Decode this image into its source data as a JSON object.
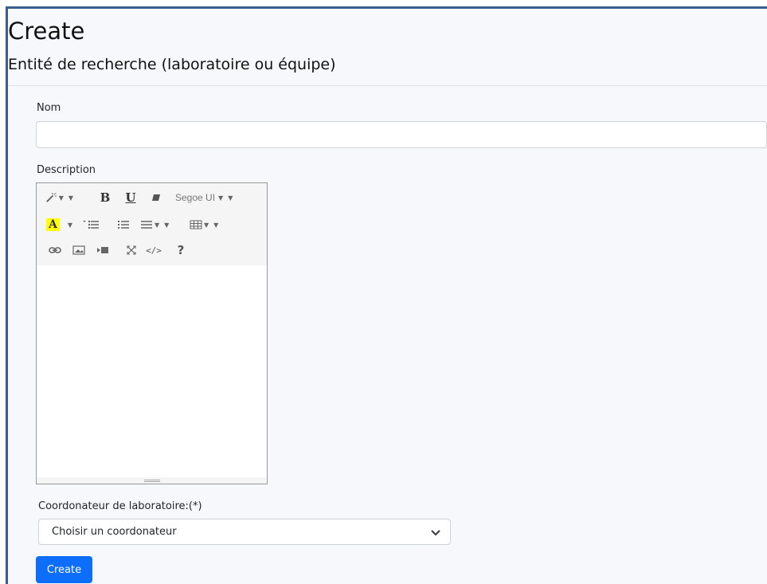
{
  "page": {
    "title": "Create",
    "subtitle": "Entité de recherche (laboratoire ou équipe)"
  },
  "form": {
    "nom_label": "Nom",
    "nom_value": "",
    "description_label": "Description",
    "coordonateur_label": "Coordonateur de laboratoire:(*)",
    "coordonateur_selected": "Choisir un coordonateur",
    "create_button": "Create"
  },
  "editor": {
    "font_name": "Segoe UI",
    "color_letter": "A",
    "help_symbol": "?",
    "code_symbol": "</>",
    "bold_letter": "B",
    "underline_letter": "U",
    "toolbar_icons": [
      "magic-style-icon",
      "bold-icon",
      "underline-icon",
      "eraser-icon",
      "font-name-dropdown",
      "text-color-icon",
      "unordered-list-icon",
      "ordered-list-icon",
      "paragraph-align-icon",
      "table-icon",
      "link-icon",
      "picture-icon",
      "video-icon",
      "fullscreen-icon",
      "code-view-icon",
      "help-icon"
    ],
    "highlight_color": "#ffff00"
  },
  "colors": {
    "primary": "#0d6efd",
    "frame_border": "#3a5f8f",
    "page_background": "#f6f8fc"
  }
}
